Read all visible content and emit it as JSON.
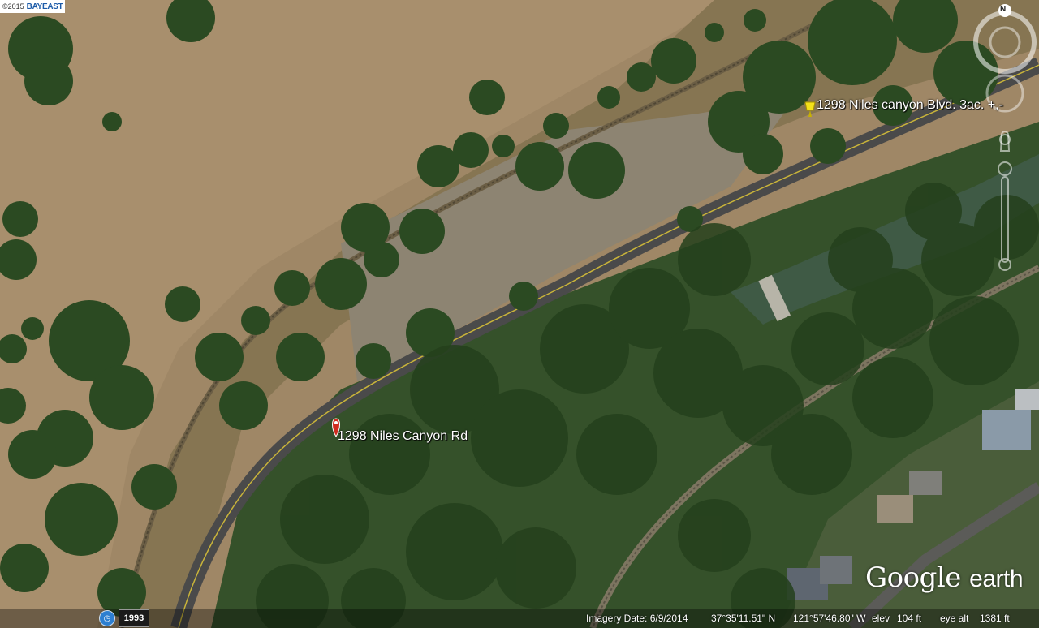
{
  "copyright": {
    "year_text": "©2015",
    "brand": "BAYEAST"
  },
  "placemarks": [
    {
      "label": "1298 Niles Canyon Rd",
      "type": "red-balloon"
    },
    {
      "label": "1298 Niles canyon Blvd. 3ac. +,-",
      "type": "yellow-pushpin"
    }
  ],
  "nav": {
    "north_label": "N"
  },
  "status_bar": {
    "historical_year": "1993",
    "imagery_date": "Imagery Date: 6/9/2014",
    "latitude": "37°35'11.51\" N",
    "longitude": "121°57'46.80\" W",
    "elev_label": "elev",
    "elev_value": "104 ft",
    "eye_alt_label": "eye alt",
    "eye_alt_value": "1381 ft"
  },
  "logo": {
    "google": "Google",
    "earth": "earth"
  },
  "colors": {
    "hill": "#a48a66",
    "tree": "#2b4a22",
    "forest": "#35512a",
    "road": "#4a4a4a",
    "creek": "#3f5a45",
    "gravel": "#8d8472"
  }
}
